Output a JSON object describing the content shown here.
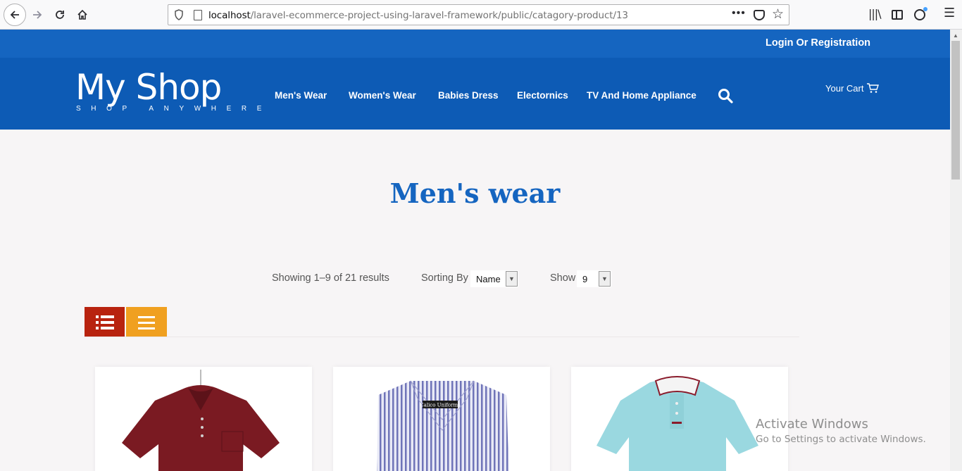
{
  "browser": {
    "url_host": "localhost",
    "url_path": "/laravel-ecommerce-project-using-laravel-framework/public/catagory-product/13"
  },
  "topbar": {
    "login_label": "Login Or Registration"
  },
  "header": {
    "logo_title": "My Shop",
    "logo_tagline": "SHOP ANYWHERE",
    "nav": [
      {
        "label": "Men's Wear"
      },
      {
        "label": "Women's Wear"
      },
      {
        "label": "Babies Dress"
      },
      {
        "label": "Electornics"
      },
      {
        "label": "TV And Home Appliance"
      }
    ],
    "cart_label": "Your Cart"
  },
  "page": {
    "title": "Men's wear",
    "showing_text": "Showing 1–9 of 21 results",
    "sort_label": "Sorting By",
    "sort_value": "Name",
    "show_label": "Show",
    "show_value": "9"
  },
  "products": [
    {
      "image": "maroon-polo-shirt",
      "color": "#7a1a22"
    },
    {
      "image": "striped-dress-shirt",
      "label": "Calico Uniforms",
      "color": "#6f74b8"
    },
    {
      "image": "light-blue-polo-shirt",
      "color": "#9ad8e0"
    }
  ],
  "watermark": {
    "title": "Activate Windows",
    "subtitle": "Go to Settings to activate Windows."
  },
  "colors": {
    "topbar": "#1565c0",
    "header": "#0d5bb5",
    "title": "#1565c0",
    "list_view": "#b8230f",
    "grid_view": "#f0a020"
  }
}
